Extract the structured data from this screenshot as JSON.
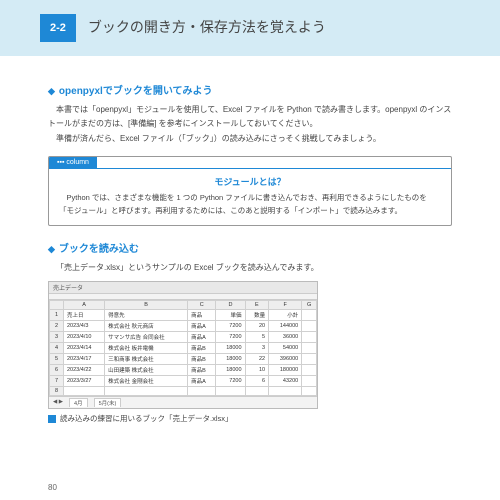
{
  "header": {
    "section_number": "2-2",
    "title": "ブックの開き方・保存方法を覚えよう"
  },
  "sec1": {
    "heading": "openpyxlでブックを開いてみよう",
    "p1": "本書では「openpyxl」モジュールを使用して、Excel ファイルを Python で読み書きします。openpyxl のインストールがまだの方は、[準備編] を参考にインストールしておいてください。",
    "p2": "準備が済んだら、Excel ファイル（「ブック」）の読み込みにさっそく挑戦してみましょう。"
  },
  "column": {
    "tab": "▪▪▪  column",
    "title": "モジュールとは？",
    "body": "Python では、さまざまな機能を 1 つの Python ファイルに書き込んでおき、再利用できるようにしたものを「モジュール」と呼びます。再利用するためには、このあと説明する「インポート」で読み込みます。"
  },
  "sec2": {
    "heading": "ブックを読み込む",
    "p1": "「売上データ.xlsx」というサンプルの Excel ブックを読み込んでみます。"
  },
  "spreadsheet": {
    "title": "売上データ",
    "cols": [
      "A",
      "B",
      "C",
      "D",
      "E",
      "F",
      "G"
    ],
    "headers": [
      "売上日",
      "得意先",
      "商品",
      "単価",
      "数量",
      "小計",
      ""
    ],
    "rows": [
      [
        "2023/4/3",
        "株式会社 秋元商店",
        "商品A",
        "7200",
        "20",
        "144000",
        ""
      ],
      [
        "2023/4/10",
        "サマンサ広告 合同会社",
        "商品A",
        "7200",
        "5",
        "36000",
        ""
      ],
      [
        "2023/4/14",
        "株式会社 板井電機",
        "商品B",
        "18000",
        "3",
        "54000",
        ""
      ],
      [
        "2023/4/17",
        "三和商事 株式会社",
        "商品B",
        "18000",
        "22",
        "396000",
        ""
      ],
      [
        "2023/4/22",
        "山田建築 株式会社",
        "商品B",
        "18000",
        "10",
        "180000",
        ""
      ],
      [
        "2023/3/27",
        "株式会社 金剛会社",
        "商品A",
        "7200",
        "6",
        "43200",
        ""
      ]
    ],
    "sheet_tabs": [
      "4月",
      "5月(未)"
    ],
    "tab_prefix": "◀ ▶"
  },
  "caption": "読み込みの練習に用いるブック「売上データ.xlsx」",
  "page": "80"
}
